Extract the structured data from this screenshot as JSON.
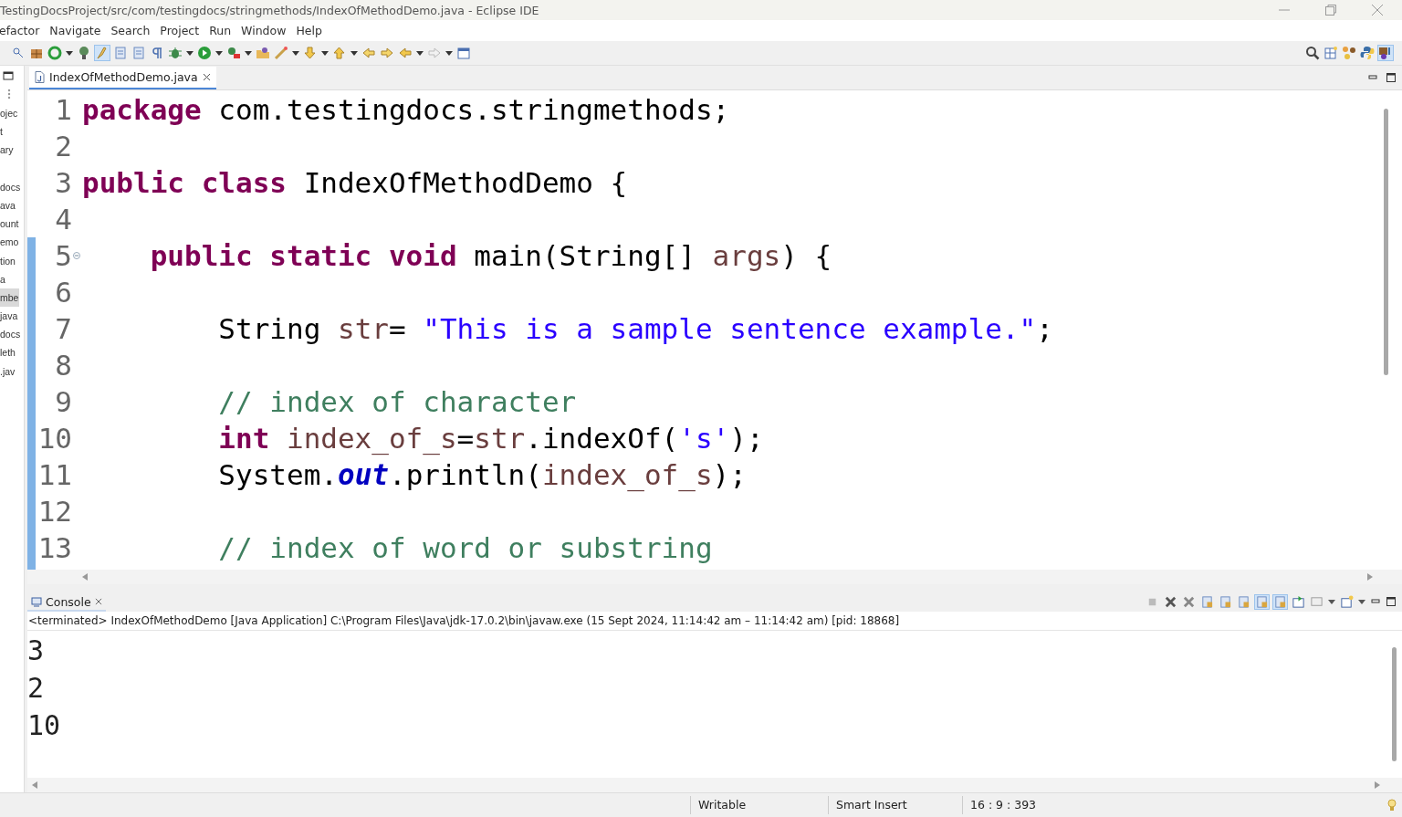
{
  "window": {
    "title": "TestingDocsProject/src/com/testingdocs/stringmethods/IndexOfMethodDemo.java - Eclipse IDE"
  },
  "menu": [
    "efactor",
    "Navigate",
    "Search",
    "Project",
    "Run",
    "Window",
    "Help"
  ],
  "side_panel": {
    "items": [
      {
        "label": "ojec",
        "selected": false
      },
      {
        "label": "t",
        "selected": false
      },
      {
        "label": "ary",
        "selected": false
      },
      {
        "label": "docs",
        "selected": false
      },
      {
        "label": "ava",
        "selected": false
      },
      {
        "label": "ount",
        "selected": false
      },
      {
        "label": "emo",
        "selected": false
      },
      {
        "label": "tion",
        "selected": false
      },
      {
        "label": "a",
        "selected": false
      },
      {
        "label": "mbe",
        "selected": true
      },
      {
        "label": "java",
        "selected": false
      },
      {
        "label": "docs",
        "selected": false
      },
      {
        "label": "leth",
        "selected": false
      },
      {
        "label": ".jav",
        "selected": false
      }
    ]
  },
  "editor": {
    "tab": {
      "label": "IndexOfMethodDemo.java",
      "selected": true
    },
    "lines": [
      {
        "number": "1",
        "tokens": [
          {
            "text": "package",
            "kind": "keyword"
          },
          {
            "text": " com.testingdocs.stringmethods;",
            "kind": "plain"
          }
        ]
      },
      {
        "number": "2"
      },
      {
        "number": "3",
        "tokens": [
          {
            "text": "public class",
            "kind": "keyword"
          },
          {
            "text": " IndexOfMethodDemo {",
            "kind": "plain"
          }
        ]
      },
      {
        "number": "4"
      },
      {
        "number": "5",
        "folded": false,
        "tokens": [
          {
            "text": "    public static void",
            "kind": "keyword"
          },
          {
            "text": " main(String[] ",
            "kind": "plain"
          },
          {
            "text": "args",
            "kind": "variable"
          },
          {
            "text": ") {",
            "kind": "plain"
          }
        ]
      },
      {
        "number": "6"
      },
      {
        "number": "7",
        "tokens": [
          {
            "text": "        String ",
            "kind": "plain"
          },
          {
            "text": "str",
            "kind": "variable"
          },
          {
            "text": "= ",
            "kind": "plain"
          },
          {
            "text": "\"This is a sample sentence example.\"",
            "kind": "string"
          },
          {
            "text": ";",
            "kind": "plain"
          }
        ]
      },
      {
        "number": "8"
      },
      {
        "number": "9",
        "tokens": [
          {
            "text": "        // index of character",
            "kind": "comment"
          }
        ]
      },
      {
        "number": "10",
        "tokens": [
          {
            "text": "        int ",
            "kind": "keyword"
          },
          {
            "text": "index_of_s",
            "kind": "variable"
          },
          {
            "text": "=",
            "kind": "plain"
          },
          {
            "text": "str",
            "kind": "variable"
          },
          {
            "text": ".indexOf(",
            "kind": "plain"
          },
          {
            "text": "'s'",
            "kind": "string"
          },
          {
            "text": ");",
            "kind": "plain"
          }
        ]
      },
      {
        "number": "11",
        "tokens": [
          {
            "text": "        System.",
            "kind": "plain"
          },
          {
            "text": "out",
            "kind": "field"
          },
          {
            "text": ".println(",
            "kind": "plain"
          },
          {
            "text": "index_of_s",
            "kind": "variable"
          },
          {
            "text": ");",
            "kind": "plain"
          }
        ]
      },
      {
        "number": "12"
      },
      {
        "number": "13",
        "tokens": [
          {
            "text": "        // index of word or substring",
            "kind": "comment"
          }
        ]
      }
    ]
  },
  "console": {
    "tab": {
      "label": "Console",
      "selected": true
    },
    "description": "<terminated> IndexOfMethodDemo [Java Application] C:\\Program Files\\Java\\jdk-17.0.2\\bin\\javaw.exe  (15 Sept 2024, 11:14:42 am – 11:14:42 am) [pid: 18868]",
    "output": [
      "3",
      "2",
      "10"
    ]
  },
  "status_bar": {
    "mode": "Writable",
    "insert": "Smart Insert",
    "position": "16 : 9 : 393"
  }
}
